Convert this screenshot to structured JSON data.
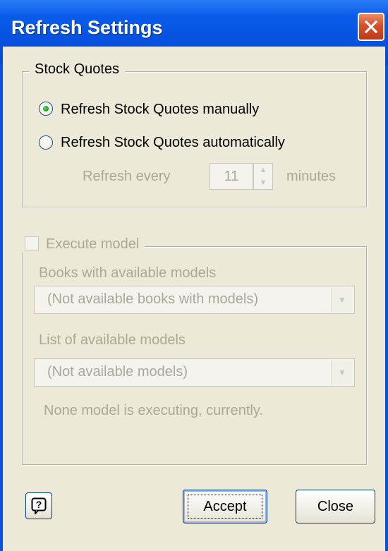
{
  "window": {
    "title": "Refresh Settings",
    "close_icon": "close-x-icon",
    "titlebar_color": "#0a52e0",
    "close_color": "#d5502c"
  },
  "stock_quotes": {
    "legend": "Stock Quotes",
    "option_manual": "Refresh Stock Quotes manually",
    "option_auto": "Refresh Stock Quotes automatically",
    "selected": "manual",
    "refresh_every_label": "Refresh every",
    "refresh_value": "11",
    "minutes_label": "minutes"
  },
  "execute_model": {
    "checkbox_label": "Execute model",
    "checked": false,
    "books_label": "Books with available models",
    "books_value": "(Not available books with models)",
    "models_label": "List of available models",
    "models_value": "(Not available models)",
    "status_text": "None model is executing, currently."
  },
  "footer": {
    "help_icon": "help-question-icon",
    "accept_label": "Accept",
    "close_label": "Close"
  },
  "colors": {
    "dialog_bg": "#ece9d8",
    "disabled_text": "#aca899",
    "radio_dot": "#21a121"
  }
}
